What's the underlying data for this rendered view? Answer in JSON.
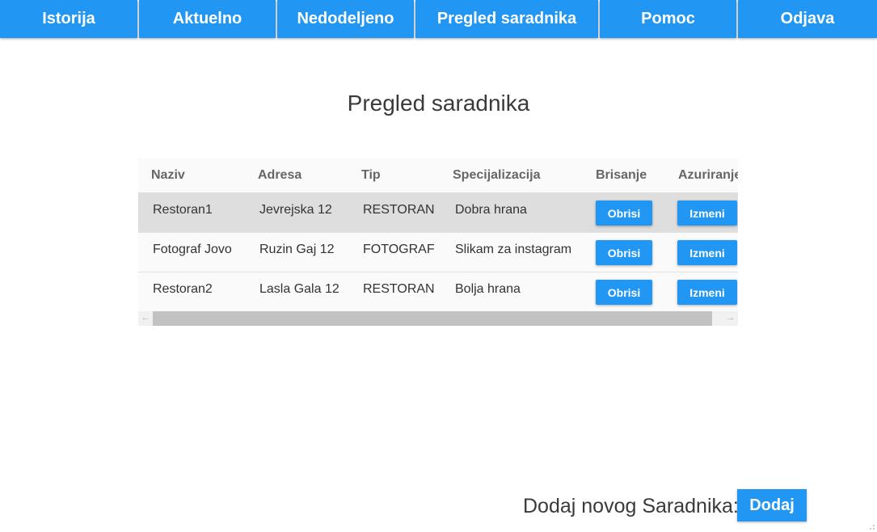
{
  "nav": {
    "items": [
      {
        "label": "Istorija"
      },
      {
        "label": "Aktuelno"
      },
      {
        "label": "Nedodeljeno"
      },
      {
        "label": "Pregled saradnika"
      },
      {
        "label": "Pomoc"
      },
      {
        "label": "Odjava"
      }
    ]
  },
  "main": {
    "title": "Pregled saradnika"
  },
  "table": {
    "headers": {
      "naziv": "Naziv",
      "adresa": "Adresa",
      "tip": "Tip",
      "specijalizacija": "Specijalizacija",
      "brisanje": "Brisanje",
      "azuriranje": "Azuriranje"
    },
    "rows": [
      {
        "naziv": "Restoran1",
        "adresa": "Jevrejska 12",
        "tip": "RESTORAN",
        "specijalizacija": "Dobra hrana",
        "delete_label": "Obrisi",
        "edit_label": "Izmeni"
      },
      {
        "naziv": "Fotograf Jovo",
        "adresa": "Ruzin Gaj 12",
        "tip": "FOTOGRAF",
        "specijalizacija": "Slikam za instagram",
        "delete_label": "Obrisi",
        "edit_label": "Izmeni"
      },
      {
        "naziv": "Restoran2",
        "adresa": "Lasla Gala 12",
        "tip": "RESTORAN",
        "specijalizacija": "Bolja hrana",
        "delete_label": "Obrisi",
        "edit_label": "Izmeni"
      }
    ]
  },
  "footer": {
    "add_label": "Dodaj novog Saradnika:",
    "add_button": "Dodaj"
  },
  "colors": {
    "accent": "#2196f3",
    "row_hover": "#dedede"
  }
}
